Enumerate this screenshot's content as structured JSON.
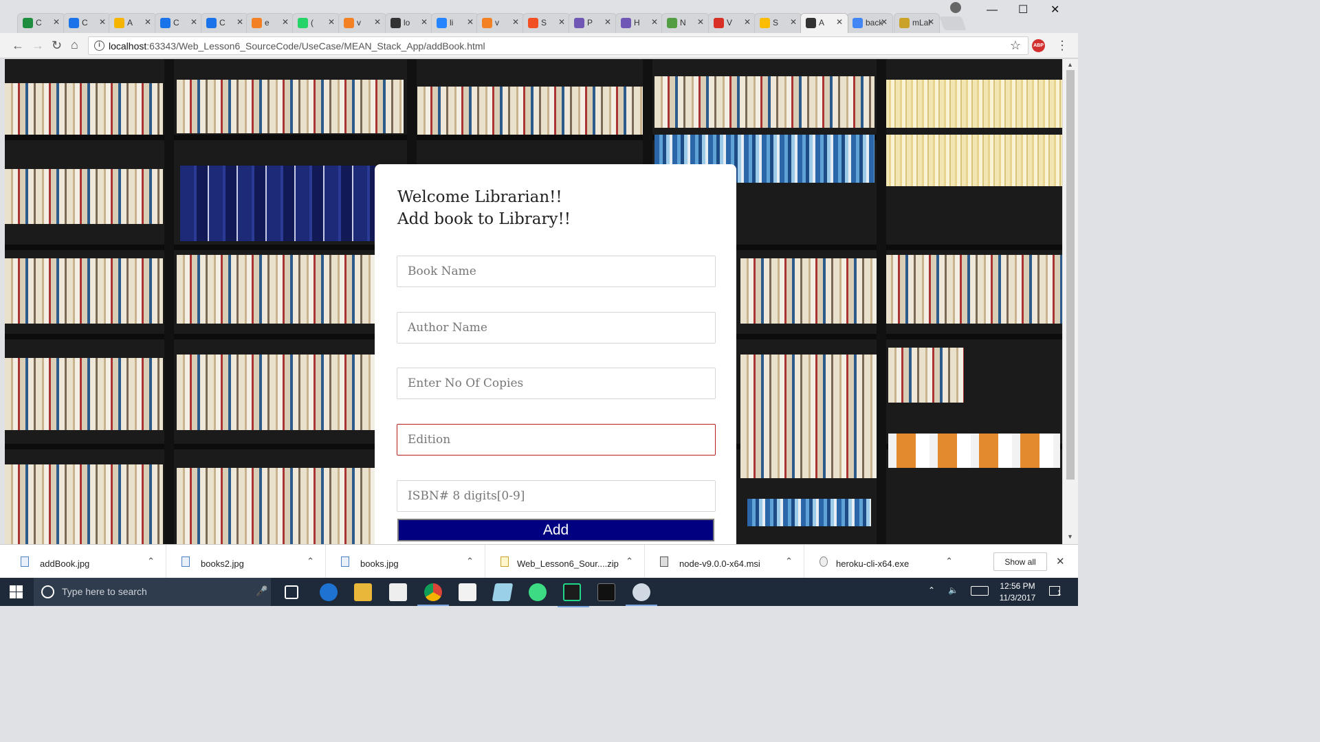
{
  "browser": {
    "tabs": [
      {
        "title": "C",
        "icon": "sheets-icon",
        "color": "#1e8e3e"
      },
      {
        "title": "C",
        "icon": "box-icon",
        "color": "#1a73e8"
      },
      {
        "title": "A",
        "icon": "slides-icon",
        "color": "#f4b400"
      },
      {
        "title": "C",
        "icon": "box-icon",
        "color": "#1a73e8"
      },
      {
        "title": "C",
        "icon": "box-icon",
        "color": "#1a73e8"
      },
      {
        "title": "e",
        "icon": "stack-icon",
        "color": "#f48024"
      },
      {
        "title": "(",
        "icon": "whatsapp-icon",
        "color": "#25d366"
      },
      {
        "title": "v",
        "icon": "stack-icon",
        "color": "#f48024"
      },
      {
        "title": "lo",
        "icon": "webstorm-icon",
        "color": "#333333"
      },
      {
        "title": "li",
        "icon": "atlassian-icon",
        "color": "#2684ff"
      },
      {
        "title": "v",
        "icon": "stack-icon",
        "color": "#f48024"
      },
      {
        "title": "S",
        "icon": "microsoft-icon",
        "color": "#f25022"
      },
      {
        "title": "P",
        "icon": "heroku-icon",
        "color": "#7057b5"
      },
      {
        "title": "H",
        "icon": "heroku-icon",
        "color": "#7057b5"
      },
      {
        "title": "N",
        "icon": "node-icon",
        "color": "#539e43"
      },
      {
        "title": "V",
        "icon": "gmail-icon",
        "color": "#d93025"
      },
      {
        "title": "S",
        "icon": "drive-icon",
        "color": "#fbbc04"
      },
      {
        "title": "A",
        "icon": "webstorm-icon",
        "color": "#333333",
        "active": true
      },
      {
        "title": "back",
        "icon": "google-icon",
        "color": "#4285f4"
      },
      {
        "title": "mLal",
        "icon": "mlab-icon",
        "color": "#c9a227"
      }
    ],
    "url_host": "localhost",
    "url_path": ":63343/Web_Lesson6_SourceCode/UseCase/MEAN_Stack_App/addBook.html"
  },
  "form": {
    "heading_line1": "Welcome Librarian!!",
    "heading_line2": "Add book to Library!!",
    "book_name_placeholder": "Book Name",
    "author_name_placeholder": "Author Name",
    "copies_placeholder": "Enter No Of Copies",
    "edition_placeholder": "Edition",
    "isbn_placeholder": "ISBN# 8 digits[0-9]",
    "add_label": "Add"
  },
  "downloads": {
    "items": [
      "addBook.jpg",
      "books2.jpg",
      "books.jpg",
      "Web_Lesson6_Sour....zip",
      "node-v9.0.0-x64.msi",
      "heroku-cli-x64.exe"
    ],
    "show_all": "Show all"
  },
  "taskbar": {
    "search_placeholder": "Type here to search",
    "time": "12:56 PM",
    "date": "11/3/2017",
    "notifications": "1"
  }
}
